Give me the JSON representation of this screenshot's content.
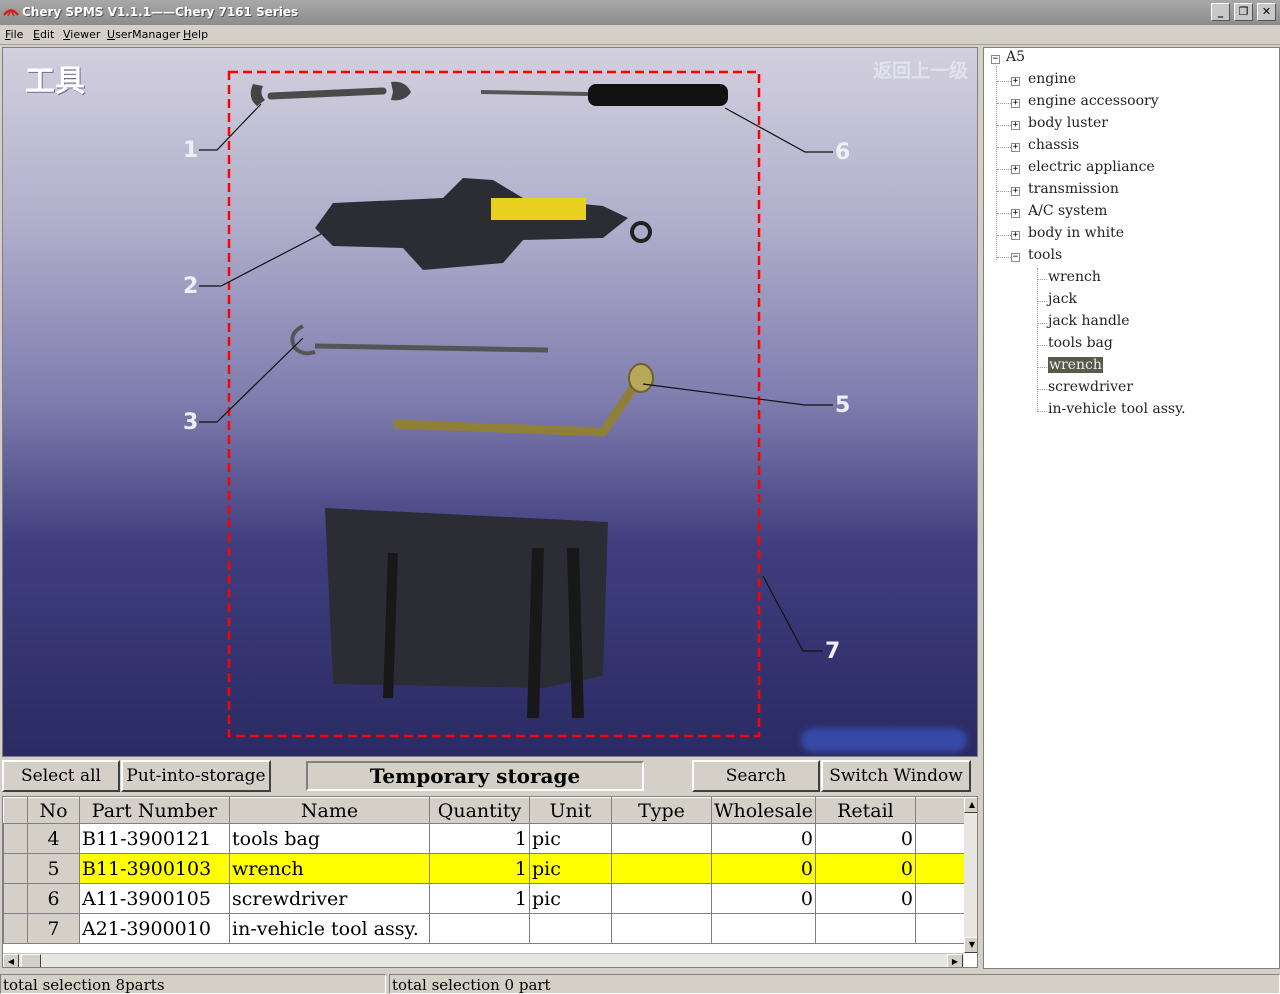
{
  "window": {
    "title": "Chery SPMS V1.1.1——Chery 7161 Series"
  },
  "menu": [
    "File",
    "Edit",
    "Viewer",
    "UserManager",
    "Help"
  ],
  "diagram": {
    "heading": "工具",
    "back_link": "返回上一级",
    "callouts": [
      "1",
      "2",
      "3",
      "5",
      "6",
      "7"
    ]
  },
  "tree": {
    "root": "A5",
    "categories": [
      "engine",
      "engine accessoory",
      "body luster",
      "chassis",
      "electric appliance",
      "transmission",
      "A/C system",
      "body in white",
      "tools"
    ],
    "tools_children": [
      "wrench",
      "jack",
      "jack handle",
      "tools bag",
      "wrench",
      "screwdriver",
      "in-vehicle tool assy."
    ],
    "selected_child_index": 4
  },
  "toolbar": {
    "select_all": "Select all",
    "put_into_storage": "Put-into-storage",
    "panel_title": "Temporary storage",
    "search": "Search",
    "switch_window": "Switch Window"
  },
  "table": {
    "headers": [
      "No",
      "Part Number",
      "Name",
      "Quantity",
      "Unit",
      "Type",
      "Wholesale",
      "Retail"
    ],
    "rows": [
      {
        "no": "4",
        "part": "B11-3900121",
        "name": "tools bag",
        "qty": "1",
        "unit": "pic",
        "type": "",
        "wholesale": "0",
        "retail": "0"
      },
      {
        "no": "5",
        "part": "B11-3900103",
        "name": "wrench",
        "qty": "1",
        "unit": "pic",
        "type": "",
        "wholesale": "0",
        "retail": "0"
      },
      {
        "no": "6",
        "part": "A11-3900105",
        "name": "screwdriver",
        "qty": "1",
        "unit": "pic",
        "type": "",
        "wholesale": "0",
        "retail": "0"
      },
      {
        "no": "7",
        "part": "A21-3900010",
        "name": "in-vehicle tool assy.",
        "qty": "",
        "unit": "",
        "type": "",
        "wholesale": "",
        "retail": ""
      }
    ],
    "highlight_row": 1
  },
  "status": {
    "left": "total selection 8parts",
    "right": "total selection 0 part"
  },
  "colors": {
    "highlight": "#ffff00",
    "callout_box": "#ff0000"
  }
}
